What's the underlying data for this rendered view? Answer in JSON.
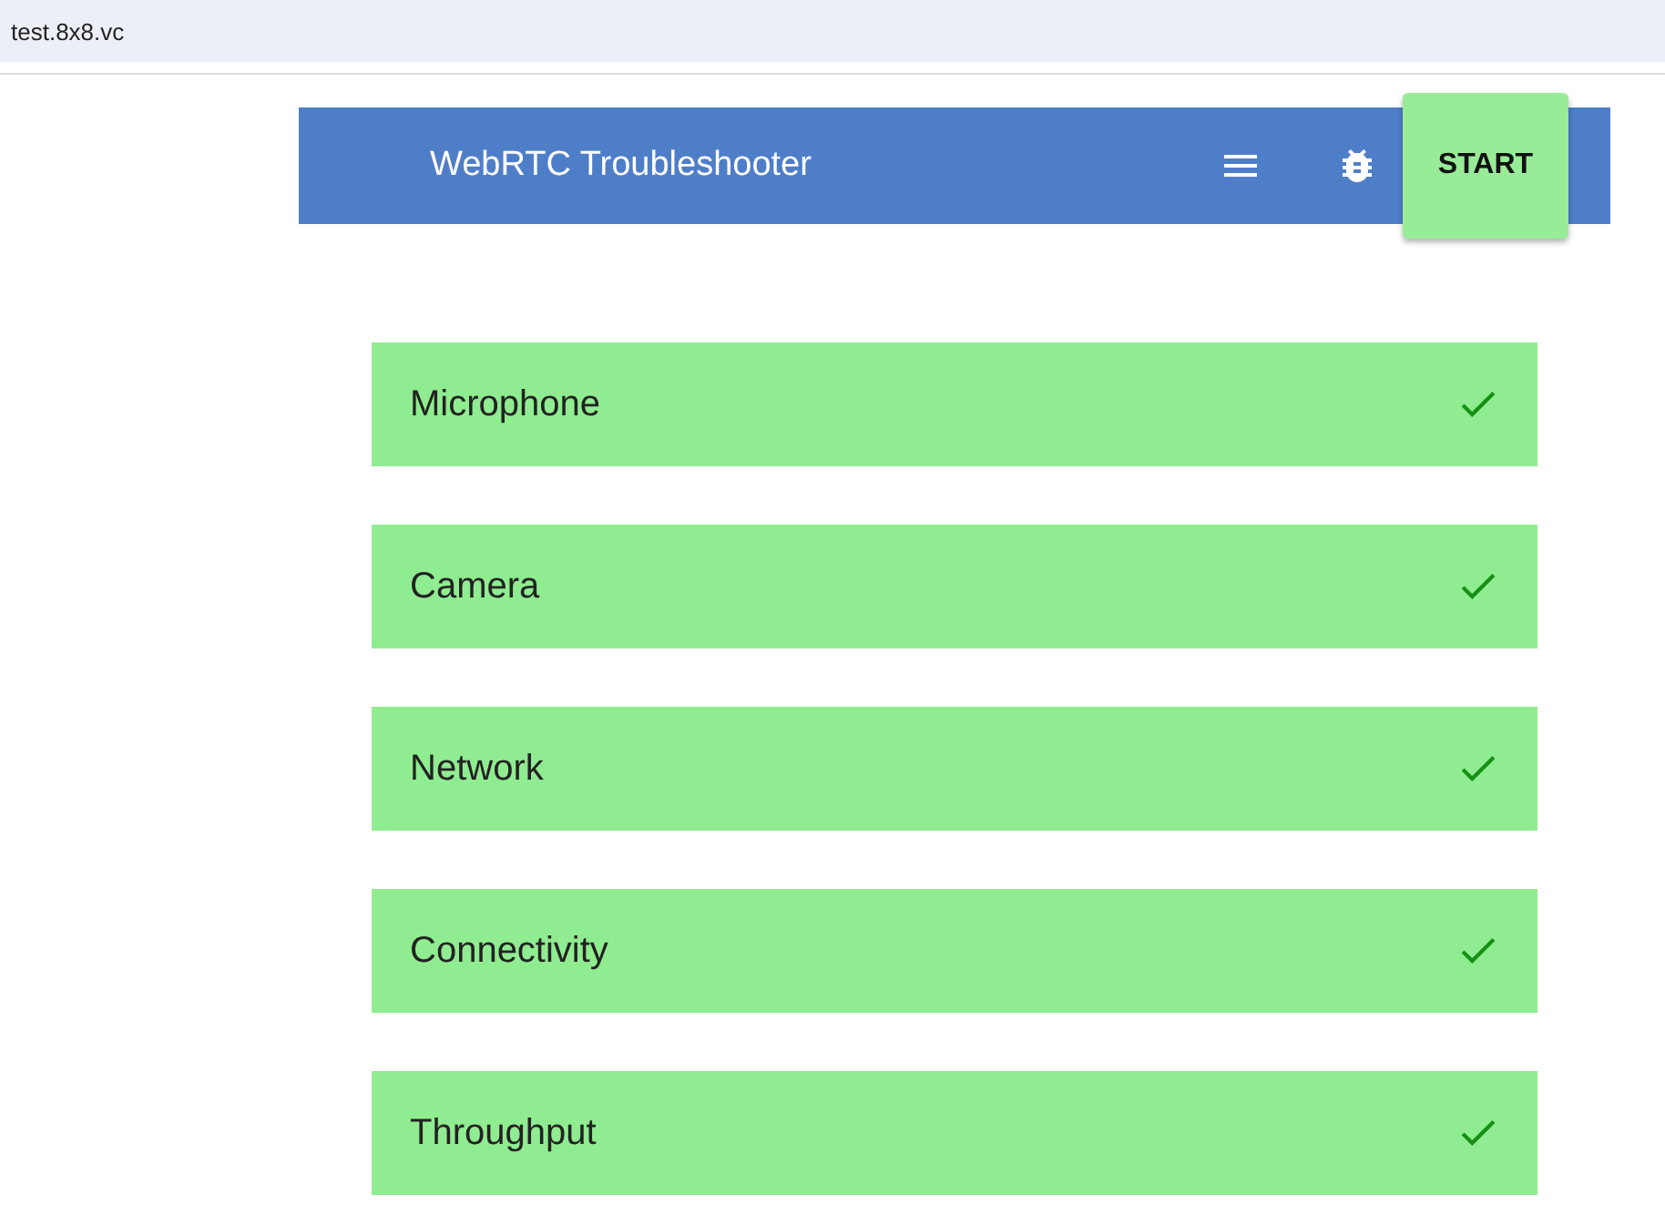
{
  "address_bar": {
    "url": "test.8x8.vc"
  },
  "header": {
    "title": "WebRTC Troubleshooter",
    "start_button": "START"
  },
  "tests": [
    {
      "name": "Microphone",
      "passed": true
    },
    {
      "name": "Camera",
      "passed": true
    },
    {
      "name": "Network",
      "passed": true
    },
    {
      "name": "Connectivity",
      "passed": true
    },
    {
      "name": "Throughput",
      "passed": true
    }
  ]
}
